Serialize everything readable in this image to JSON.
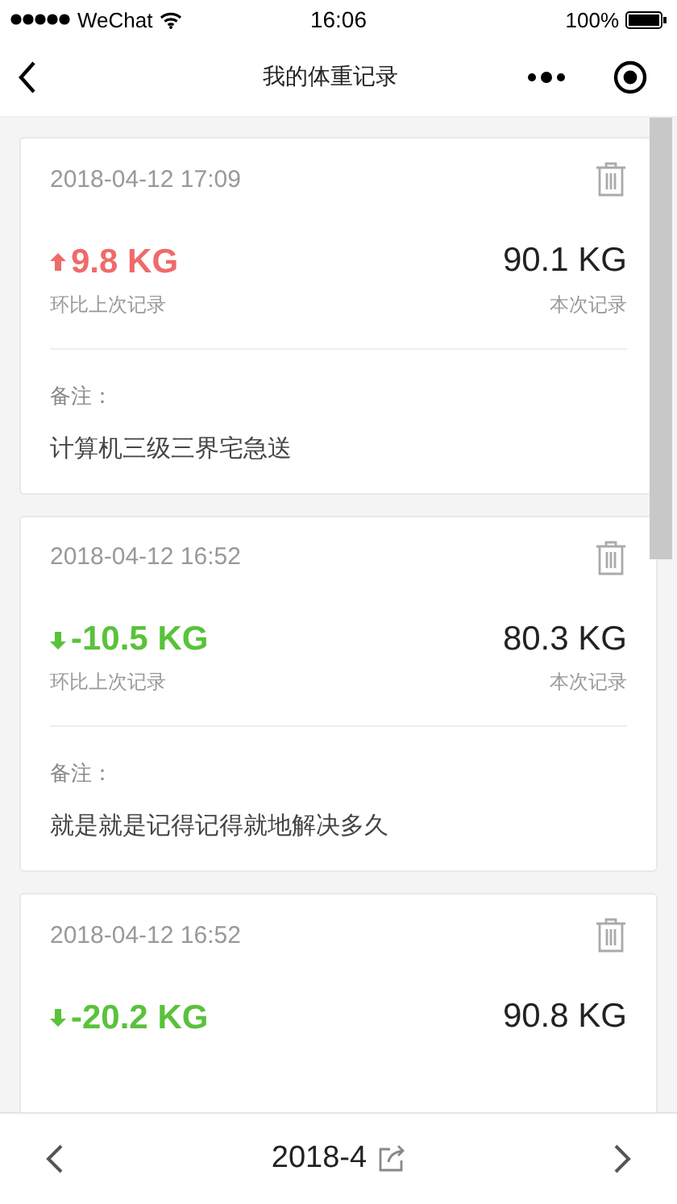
{
  "status_bar": {
    "carrier": "WeChat",
    "time": "16:06",
    "battery": "100%"
  },
  "nav_bar": {
    "title": "我的体重记录"
  },
  "records": [
    {
      "time": "2018-04-12 17:09",
      "kind": "increase",
      "change": "9.8 KG",
      "change_label": "环比上次记录",
      "current": "90.1 KG",
      "current_label": "本次记录",
      "note_label": "备注：",
      "note": "计算机三级三界宅急送"
    },
    {
      "time": "2018-04-12 16:52",
      "kind": "decrease",
      "change": "-10.5 KG",
      "change_label": "环比上次记录",
      "current": "80.3 KG",
      "current_label": "本次记录",
      "note_label": "备注：",
      "note": "就是就是记得记得就地解决多久"
    },
    {
      "time": "2018-04-12 16:52",
      "kind": "decrease",
      "change": "-20.2 KG",
      "current": "90.8 KG"
    }
  ],
  "bottom_bar": {
    "month": "2018-4"
  }
}
